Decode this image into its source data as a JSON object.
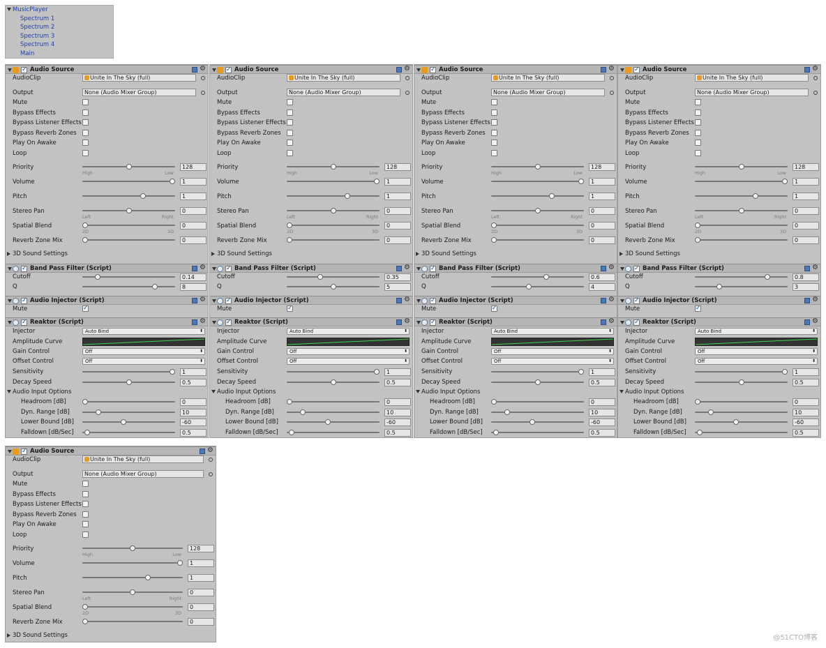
{
  "hierarchy": {
    "root": "MusicPlayer",
    "children": [
      "Spectrum 1",
      "Spectrum 2",
      "Spectrum 3",
      "Spectrum 4",
      "Main"
    ]
  },
  "labels": {
    "audio_source": "Audio Source",
    "audio_clip": "AudioClip",
    "output": "Output",
    "mute": "Mute",
    "bypass_effects": "Bypass Effects",
    "bypass_listener": "Bypass Listener Effects",
    "bypass_reverb": "Bypass Reverb Zones",
    "play_on_awake": "Play On Awake",
    "loop": "Loop",
    "priority": "Priority",
    "volume": "Volume",
    "pitch": "Pitch",
    "stereo_pan": "Stereo Pan",
    "spatial_blend": "Spatial Blend",
    "reverb_zone_mix": "Reverb Zone Mix",
    "sound_settings_3d": "3D Sound Settings",
    "high": "High",
    "low": "Low",
    "left": "Left",
    "right": "Right",
    "d2": "2D",
    "d3": "3D",
    "band_pass": "Band Pass Filter (Script)",
    "cutoff": "Cutoff",
    "q": "Q",
    "audio_injector": "Audio Injector (Script)",
    "reaktor": "Reaktor (Script)",
    "injector": "Injector",
    "amplitude_curve": "Amplitude Curve",
    "gain_control": "Gain Control",
    "offset_control": "Offset Control",
    "sensitivity": "Sensitivity",
    "decay_speed": "Decay Speed",
    "audio_input_options": "Audio Input Options",
    "headroom": "Headroom [dB]",
    "dyn_range": "Dyn. Range [dB]",
    "lower_bound": "Lower Bound [dB]",
    "falldown": "Falldown [dB/Sec]"
  },
  "audio_source": {
    "clip": "Unite In The Sky (full)",
    "output": "None (Audio Mixer Group)",
    "priority": "128",
    "volume": "1",
    "pitch": "1",
    "stereo_pan": "0",
    "spatial_blend": "0",
    "reverb_zone_mix": "0"
  },
  "reaktor": {
    "injector": "Auto Bind",
    "gain_control": "Off",
    "offset_control": "Off",
    "sensitivity": "1",
    "decay_speed": "0.5",
    "headroom": "0",
    "dyn_range": "10",
    "lower_bound": "-60",
    "falldown": "0.5"
  },
  "spectrum_columns": [
    {
      "cutoff": "0.14",
      "q": "8",
      "cutoff_frac": 0.14,
      "q_frac": 0.8
    },
    {
      "cutoff": "0.35",
      "q": "5",
      "cutoff_frac": 0.35,
      "q_frac": 0.5
    },
    {
      "cutoff": "0.6",
      "q": "4",
      "cutoff_frac": 0.6,
      "q_frac": 0.4
    },
    {
      "cutoff": "0.8",
      "q": "3",
      "cutoff_frac": 0.8,
      "q_frac": 0.25
    }
  ],
  "watermark": "@51CTO博客"
}
